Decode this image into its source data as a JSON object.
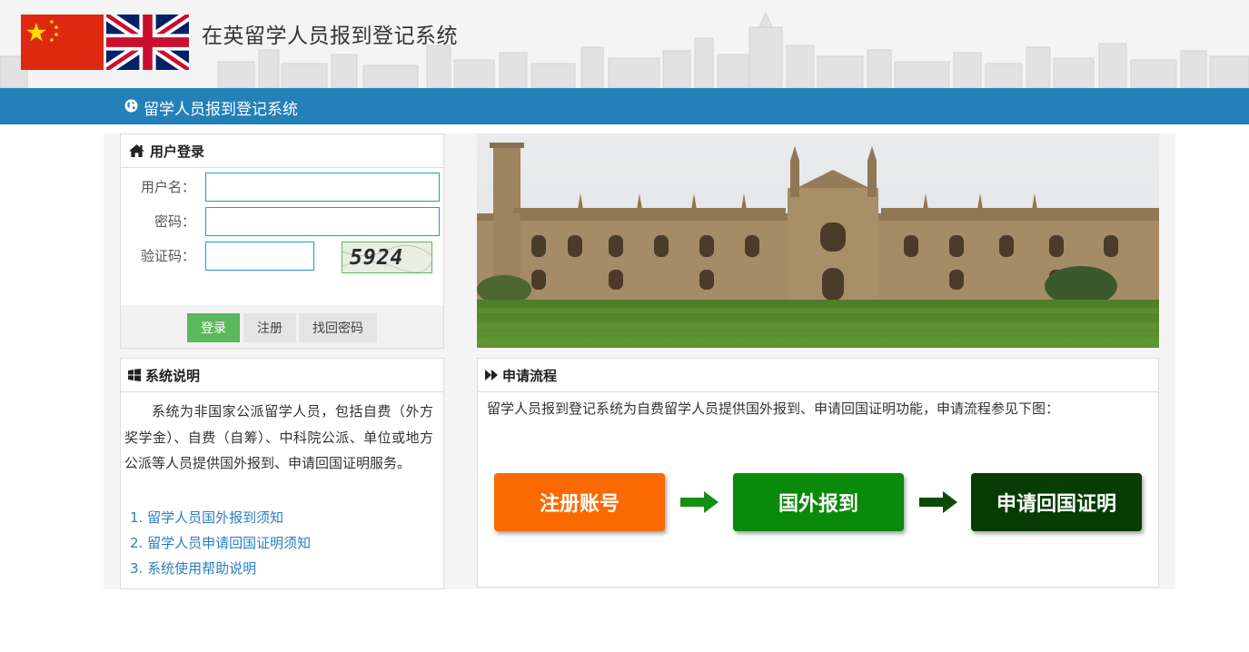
{
  "header": {
    "site_title": "在英留学人员报到登记系统",
    "flag_left": "china-flag",
    "flag_right": "uk-flag"
  },
  "navbar": {
    "title": "留学人员报到登记系统",
    "icon": "globe-icon"
  },
  "login": {
    "title": "用户登录",
    "icon": "home-icon",
    "username_label": "用户名：",
    "username_value": "",
    "password_label": "密码：",
    "password_value": "",
    "captcha_label": "验证码：",
    "captcha_value": "",
    "captcha_image_text": "5924",
    "login_button": "登录",
    "register_button": "注册",
    "recover_button": "找回密码"
  },
  "campus_photo": "college-building-image",
  "description": {
    "title": "系统说明",
    "icon": "windows-icon",
    "text": "系统为非国家公派留学人员，包括自费（外方奖学金）、自费（自筹）、中科院公派、单位或地方公派等人员提供国外报到、申请回国证明服务。",
    "links": [
      "1. 留学人员国外报到须知",
      "2. 留学人员申请回国证明须知",
      "3. 系统使用帮助说明"
    ]
  },
  "process": {
    "title": "申请流程",
    "icon": "forward-icon",
    "text": "留学人员报到登记系统为自费留学人员提供国外报到、申请回国证明功能，申请流程参见下图：",
    "steps": [
      "注册账号",
      "国外报到",
      "申请回国证明"
    ]
  },
  "colors": {
    "brand_blue": "#2480b8",
    "login_green": "#5cb85c",
    "link_blue": "#2a7fc0",
    "step_orange": "#fb6a00",
    "step_green": "#0a8a0a",
    "step_dark_green": "#073d05"
  }
}
